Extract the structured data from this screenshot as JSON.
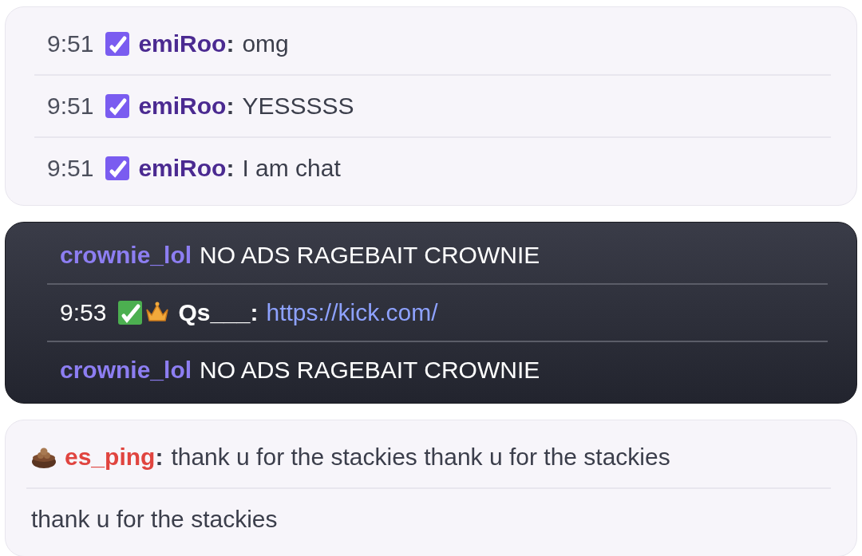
{
  "cards": [
    {
      "kind": "light",
      "messages": [
        {
          "time": "9:51",
          "badges": [
            {
              "kind": "check"
            }
          ],
          "username": "emiRoo",
          "color": "#4b2a91",
          "separator": ":",
          "text": "omg",
          "kind": "text"
        },
        {
          "time": "9:51",
          "badges": [
            {
              "kind": "check"
            }
          ],
          "username": "emiRoo",
          "color": "#4b2a91",
          "separator": ":",
          "text": "YESSSSS",
          "kind": "text"
        },
        {
          "time": "9:51",
          "badges": [
            {
              "kind": "check"
            }
          ],
          "username": "emiRoo",
          "color": "#4b2a91",
          "separator": ":",
          "text": "I am chat",
          "kind": "text"
        }
      ]
    },
    {
      "kind": "dark",
      "messages": [
        {
          "username": "crownie_lol",
          "color": "#8d7ef2",
          "text": "NO ADS RAGEBAIT CROWNIE",
          "kind": "text"
        },
        {
          "time": "9:53",
          "badges": [
            {
              "kind": "greencheck"
            },
            {
              "kind": "crown"
            }
          ],
          "username": "Qs___",
          "color": "#ffffff",
          "separator": ":",
          "text": "https://kick.com/",
          "kind": "link"
        },
        {
          "username": "crownie_lol",
          "color": "#8d7ef2",
          "text": "NO ADS RAGEBAIT CROWNIE",
          "kind": "text"
        }
      ]
    },
    {
      "kind": "light",
      "messages": [
        {
          "badges": [
            {
              "kind": "basket"
            }
          ],
          "username": "es_ping",
          "color": "#e0443f",
          "separator": ":",
          "text": "thank u for the stackies thank u for the stackies",
          "kind": "text"
        },
        {
          "text": "thank u for the stackies",
          "kind": "text"
        }
      ]
    }
  ]
}
